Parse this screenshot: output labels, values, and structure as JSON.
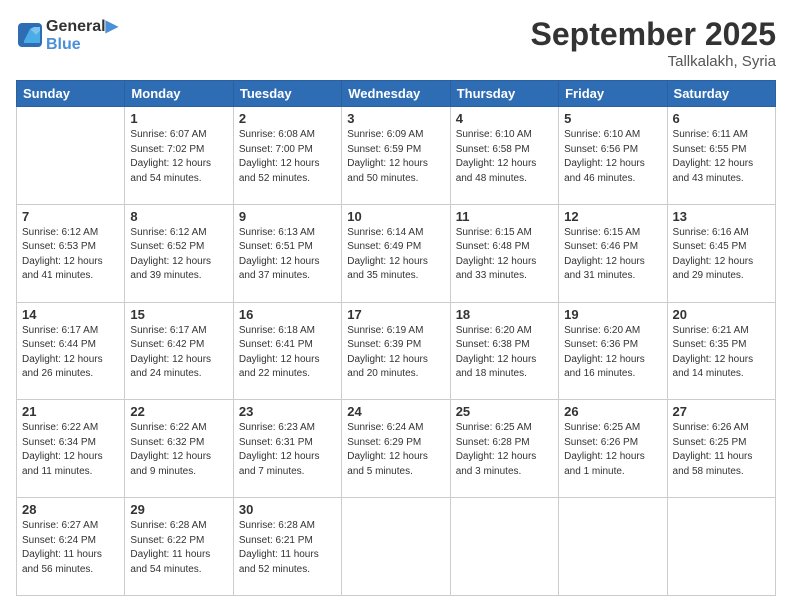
{
  "header": {
    "logo_line1": "General",
    "logo_line2": "Blue",
    "month": "September 2025",
    "location": "Tallkalakh, Syria"
  },
  "days_of_week": [
    "Sunday",
    "Monday",
    "Tuesday",
    "Wednesday",
    "Thursday",
    "Friday",
    "Saturday"
  ],
  "weeks": [
    [
      {
        "day": "",
        "info": ""
      },
      {
        "day": "1",
        "info": "Sunrise: 6:07 AM\nSunset: 7:02 PM\nDaylight: 12 hours\nand 54 minutes."
      },
      {
        "day": "2",
        "info": "Sunrise: 6:08 AM\nSunset: 7:00 PM\nDaylight: 12 hours\nand 52 minutes."
      },
      {
        "day": "3",
        "info": "Sunrise: 6:09 AM\nSunset: 6:59 PM\nDaylight: 12 hours\nand 50 minutes."
      },
      {
        "day": "4",
        "info": "Sunrise: 6:10 AM\nSunset: 6:58 PM\nDaylight: 12 hours\nand 48 minutes."
      },
      {
        "day": "5",
        "info": "Sunrise: 6:10 AM\nSunset: 6:56 PM\nDaylight: 12 hours\nand 46 minutes."
      },
      {
        "day": "6",
        "info": "Sunrise: 6:11 AM\nSunset: 6:55 PM\nDaylight: 12 hours\nand 43 minutes."
      }
    ],
    [
      {
        "day": "7",
        "info": "Sunrise: 6:12 AM\nSunset: 6:53 PM\nDaylight: 12 hours\nand 41 minutes."
      },
      {
        "day": "8",
        "info": "Sunrise: 6:12 AM\nSunset: 6:52 PM\nDaylight: 12 hours\nand 39 minutes."
      },
      {
        "day": "9",
        "info": "Sunrise: 6:13 AM\nSunset: 6:51 PM\nDaylight: 12 hours\nand 37 minutes."
      },
      {
        "day": "10",
        "info": "Sunrise: 6:14 AM\nSunset: 6:49 PM\nDaylight: 12 hours\nand 35 minutes."
      },
      {
        "day": "11",
        "info": "Sunrise: 6:15 AM\nSunset: 6:48 PM\nDaylight: 12 hours\nand 33 minutes."
      },
      {
        "day": "12",
        "info": "Sunrise: 6:15 AM\nSunset: 6:46 PM\nDaylight: 12 hours\nand 31 minutes."
      },
      {
        "day": "13",
        "info": "Sunrise: 6:16 AM\nSunset: 6:45 PM\nDaylight: 12 hours\nand 29 minutes."
      }
    ],
    [
      {
        "day": "14",
        "info": "Sunrise: 6:17 AM\nSunset: 6:44 PM\nDaylight: 12 hours\nand 26 minutes."
      },
      {
        "day": "15",
        "info": "Sunrise: 6:17 AM\nSunset: 6:42 PM\nDaylight: 12 hours\nand 24 minutes."
      },
      {
        "day": "16",
        "info": "Sunrise: 6:18 AM\nSunset: 6:41 PM\nDaylight: 12 hours\nand 22 minutes."
      },
      {
        "day": "17",
        "info": "Sunrise: 6:19 AM\nSunset: 6:39 PM\nDaylight: 12 hours\nand 20 minutes."
      },
      {
        "day": "18",
        "info": "Sunrise: 6:20 AM\nSunset: 6:38 PM\nDaylight: 12 hours\nand 18 minutes."
      },
      {
        "day": "19",
        "info": "Sunrise: 6:20 AM\nSunset: 6:36 PM\nDaylight: 12 hours\nand 16 minutes."
      },
      {
        "day": "20",
        "info": "Sunrise: 6:21 AM\nSunset: 6:35 PM\nDaylight: 12 hours\nand 14 minutes."
      }
    ],
    [
      {
        "day": "21",
        "info": "Sunrise: 6:22 AM\nSunset: 6:34 PM\nDaylight: 12 hours\nand 11 minutes."
      },
      {
        "day": "22",
        "info": "Sunrise: 6:22 AM\nSunset: 6:32 PM\nDaylight: 12 hours\nand 9 minutes."
      },
      {
        "day": "23",
        "info": "Sunrise: 6:23 AM\nSunset: 6:31 PM\nDaylight: 12 hours\nand 7 minutes."
      },
      {
        "day": "24",
        "info": "Sunrise: 6:24 AM\nSunset: 6:29 PM\nDaylight: 12 hours\nand 5 minutes."
      },
      {
        "day": "25",
        "info": "Sunrise: 6:25 AM\nSunset: 6:28 PM\nDaylight: 12 hours\nand 3 minutes."
      },
      {
        "day": "26",
        "info": "Sunrise: 6:25 AM\nSunset: 6:26 PM\nDaylight: 12 hours\nand 1 minute."
      },
      {
        "day": "27",
        "info": "Sunrise: 6:26 AM\nSunset: 6:25 PM\nDaylight: 11 hours\nand 58 minutes."
      }
    ],
    [
      {
        "day": "28",
        "info": "Sunrise: 6:27 AM\nSunset: 6:24 PM\nDaylight: 11 hours\nand 56 minutes."
      },
      {
        "day": "29",
        "info": "Sunrise: 6:28 AM\nSunset: 6:22 PM\nDaylight: 11 hours\nand 54 minutes."
      },
      {
        "day": "30",
        "info": "Sunrise: 6:28 AM\nSunset: 6:21 PM\nDaylight: 11 hours\nand 52 minutes."
      },
      {
        "day": "",
        "info": ""
      },
      {
        "day": "",
        "info": ""
      },
      {
        "day": "",
        "info": ""
      },
      {
        "day": "",
        "info": ""
      }
    ]
  ]
}
